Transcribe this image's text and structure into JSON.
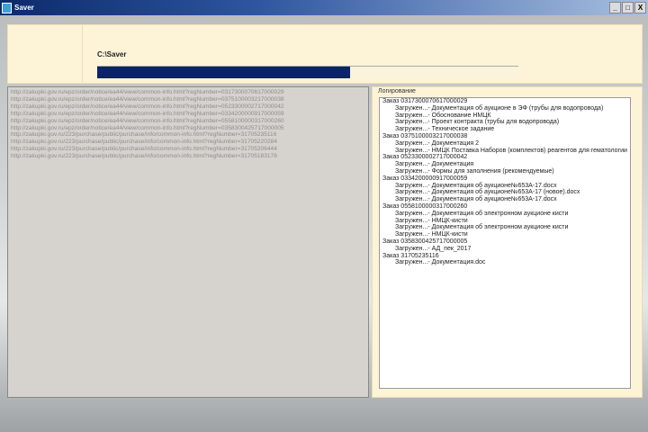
{
  "window": {
    "title": "Saver",
    "buttons": [
      "_",
      "□",
      "X"
    ]
  },
  "header": {
    "path": "C:\\Saver",
    "progress_percent": 60
  },
  "urls": [
    "http://zakupki.gov.ru/epz/order/notice/ea44/view/common-info.html?regNumber=0317300070617000029",
    "http://zakupki.gov.ru/epz/order/notice/ea44/view/common-info.html?regNumber=0375100003217000038",
    "http://zakupki.gov.ru/epz/order/notice/ea44/view/common-info.html?regNumber=0523300002717000042",
    "http://zakupki.gov.ru/epz/order/notice/ea44/view/common-info.html?regNumber=0334200000917000059",
    "http://zakupki.gov.ru/epz/order/notice/ea44/view/common-info.html?regNumber=0558100000317000260",
    "http://zakupki.gov.ru/epz/order/notice/ea44/view/common-info.html?regNumber=0358300425717000005",
    "http://zakupki.gov.ru/223/purchase/public/purchase/info/common-info.html?regNumber=31705235116",
    "http://zakupki.gov.ru/223/purchase/public/purchase/info/common-info.html?regNumber=31705220284",
    "http://zakupki.gov.ru/223/purchase/public/purchase/info/common-info.html?regNumber=31705206444",
    "http://zakupki.gov.ru/223/purchase/public/purchase/info/common-info.html?regNumber=31705183176"
  ],
  "log": {
    "title": "Логирование",
    "rows": [
      {
        "t": "order",
        "text": "Заказ 0317300070617000029"
      },
      {
        "t": "file",
        "text": "Загружен...- Документация об аукционе в ЭФ (трубы для водопровода)"
      },
      {
        "t": "file",
        "text": "Загружен...- Обоснование НМЦК"
      },
      {
        "t": "file",
        "text": "Загружен...- Проект контракта (трубы для водопровода)"
      },
      {
        "t": "file",
        "text": "Загружен...- Техническое задание"
      },
      {
        "t": "order",
        "text": "Заказ 0375100003217000038"
      },
      {
        "t": "file",
        "text": "Загружен...- Документация 2"
      },
      {
        "t": "file",
        "text": "Загружен...- НМЦК Поставка Наборов (комплектов) реагентов для гематологии"
      },
      {
        "t": "order",
        "text": "Заказ 0523300002717000042"
      },
      {
        "t": "file",
        "text": "Загружен...- Документация"
      },
      {
        "t": "file",
        "text": "Загружен...- Формы для заполнения (рекомендуемые)"
      },
      {
        "t": "order",
        "text": "Заказ 0334200000917000059"
      },
      {
        "t": "file",
        "text": "Загружен...- Документация об аукционе№653А-17.docx"
      },
      {
        "t": "file",
        "text": "Загружен...- Документация об аукционе№653А-17 (новое).docx"
      },
      {
        "t": "file",
        "text": "Загружен...- Документация об аукционе№653А-17.docx"
      },
      {
        "t": "order",
        "text": "Заказ 0558100000317000260"
      },
      {
        "t": "file",
        "text": "Загружен...- Документация об электронном аукционе кисти"
      },
      {
        "t": "file",
        "text": "Загружен...- НМЦК-кисти"
      },
      {
        "t": "file",
        "text": "Загружен...- Документация об электронном аукционе кисти"
      },
      {
        "t": "file",
        "text": "Загружен...- НМЦК-кисти"
      },
      {
        "t": "order",
        "text": "Заказ 0358300425717000005"
      },
      {
        "t": "file",
        "text": "Загружен...- АД_пек_2017"
      },
      {
        "t": "order",
        "text": "Заказ 31705235116"
      },
      {
        "t": "file",
        "text": "Загружен...- Документация.doc"
      }
    ]
  }
}
